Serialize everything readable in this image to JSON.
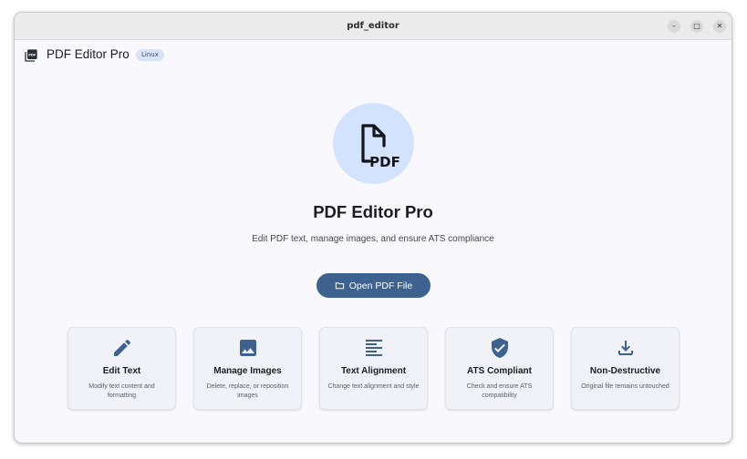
{
  "window": {
    "title": "pdf_editor",
    "controls": {
      "minimize": "–",
      "maximize": "□",
      "close": "✕"
    }
  },
  "appbar": {
    "title": "PDF Editor Pro",
    "platform_badge": "Linux",
    "logo_icon": "pdf-stack-icon"
  },
  "hero": {
    "icon": "pdf-file-icon",
    "title": "PDF Editor Pro",
    "subtitle": "Edit PDF text, manage images, and ensure ATS compliance"
  },
  "open_button": {
    "label": "Open PDF File",
    "icon": "folder-icon"
  },
  "features": [
    {
      "icon": "pencil-icon",
      "title": "Edit Text",
      "description": "Modify text content and formatting"
    },
    {
      "icon": "image-icon",
      "title": "Manage Images",
      "description": "Delete, replace, or reposition images"
    },
    {
      "icon": "align-left-icon",
      "title": "Text Alignment",
      "description": "Change text alignment and style"
    },
    {
      "icon": "shield-check-icon",
      "title": "ATS Compliant",
      "description": "Check and ensure ATS compatibility"
    },
    {
      "icon": "download-icon",
      "title": "Non-Destructive",
      "description": "Original file remains untouched"
    }
  ],
  "colors": {
    "accent": "#3d6290",
    "icon": "#3d6290",
    "hero_circle": "#d3e3fd",
    "badge": "#d8e3f7"
  }
}
